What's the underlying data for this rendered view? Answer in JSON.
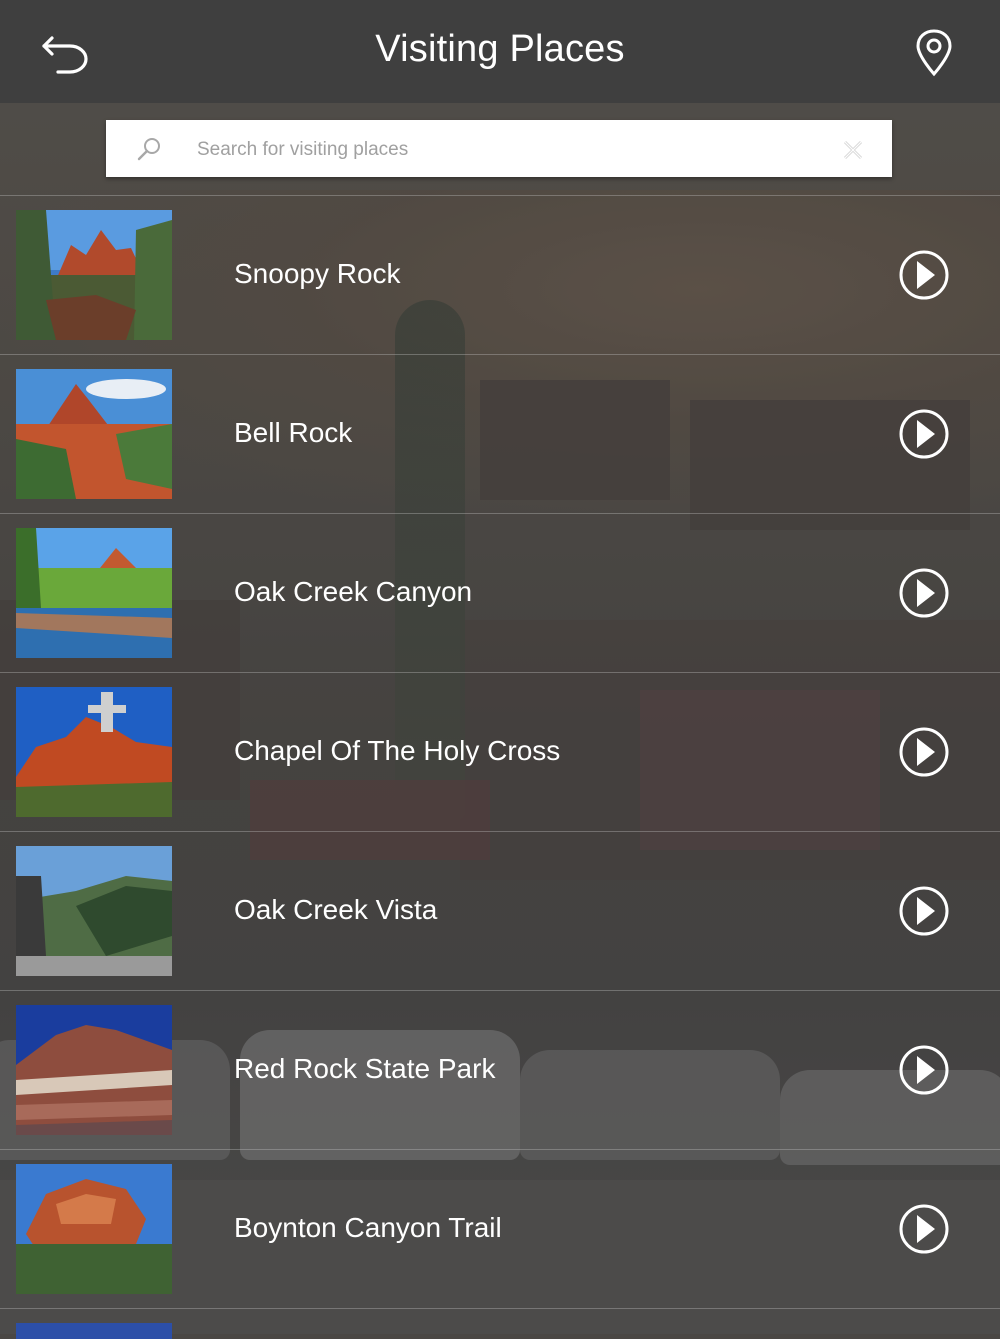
{
  "header": {
    "title": "Visiting Places",
    "back_icon": "back-arrow-icon",
    "map_icon": "location-pin-icon"
  },
  "search": {
    "placeholder": "Search for visiting places",
    "value": "",
    "search_icon": "magnifier-icon",
    "clear_icon": "clear-x-icon"
  },
  "places": [
    {
      "name": "Snoopy Rock",
      "thumb": "red-rock-spires-photo"
    },
    {
      "name": "Bell Rock",
      "thumb": "bell-rock-photo"
    },
    {
      "name": "Oak Creek Canyon",
      "thumb": "creek-reflection-photo"
    },
    {
      "name": "Chapel Of The Holy Cross",
      "thumb": "chapel-on-rocks-photo"
    },
    {
      "name": "Oak Creek Vista",
      "thumb": "canyon-vista-photo"
    },
    {
      "name": "Red Rock State Park",
      "thumb": "striped-butte-photo"
    },
    {
      "name": "Boynton Canyon Trail",
      "thumb": "canyon-trail-photo"
    }
  ],
  "colors": {
    "header_bg": "#3f3f3f",
    "text": "#ffffff",
    "placeholder": "#a0a0a0"
  }
}
